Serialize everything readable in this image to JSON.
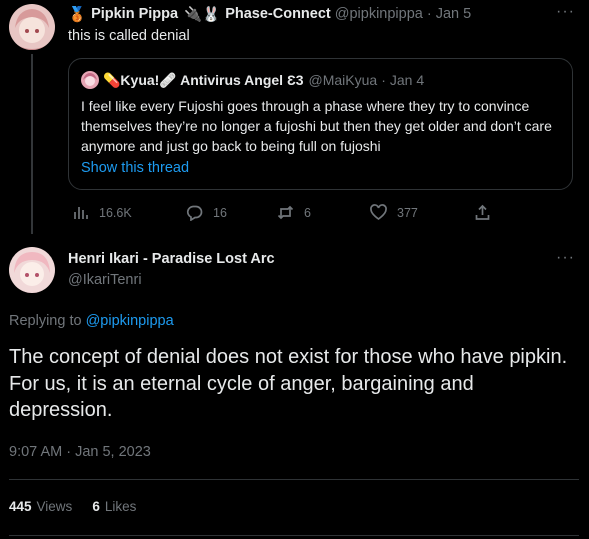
{
  "parent_tweet": {
    "author_name": "Pipkin Pippa",
    "author_name_emoji_prefix": "🥉",
    "author_name_suffix_emojis": "🔌🐰",
    "author_affiliation": "Phase-Connect",
    "handle": "@pipkinpippa",
    "separator": "·",
    "date": "Jan 5",
    "text": "this is called denial",
    "more_label": "···",
    "quote": {
      "author_name": "Kyua!",
      "author_prefix_emoji": "💊",
      "author_suffix": "🩹 Antivirus Angel 🏳",
      "author_display": "💊Kyua!🩹 Antivirus Angel Ɛ3",
      "handle": "@MaiKyua",
      "separator": "·",
      "date": "Jan 4",
      "text": "I feel like every Fujoshi goes through a phase where they try to convince themselves they’re no longer a fujoshi but then they get older and don’t care anymore and just go back to being full on fujoshi",
      "show_thread": "Show this thread"
    },
    "actions": {
      "views": "16.6K",
      "replies": "16",
      "retweets": "6",
      "likes": "377"
    }
  },
  "main_tweet": {
    "author_name": "Henri Ikari - Paradise Lost Arc",
    "handle": "@IkariTenri",
    "more_label": "···",
    "replying_prefix": "Replying to ",
    "replying_to": "@pipkinpippa",
    "text": "The concept of denial does not exist for those who have pipkin. For us, it is an eternal cycle of anger, bargaining and depression.",
    "timestamp": "9:07 AM · Jan 5, 2023",
    "views_count": "445",
    "views_label": "Views",
    "likes_count": "6",
    "likes_label": "Likes"
  },
  "colors": {
    "background": "#000000",
    "text_primary": "#e7e9ea",
    "text_secondary": "#71767b",
    "link": "#1d9bf0",
    "border": "#2f3336"
  }
}
